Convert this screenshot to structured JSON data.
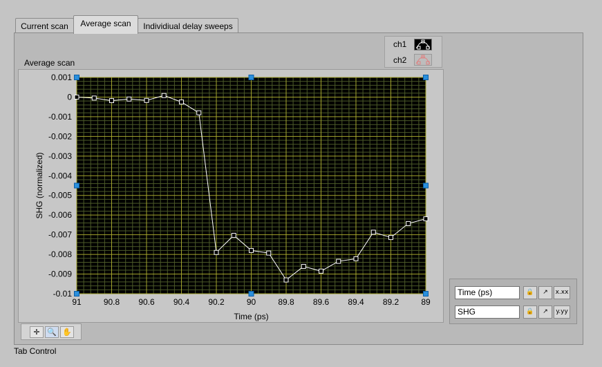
{
  "tabs": [
    {
      "label": "Current scan",
      "active": false
    },
    {
      "label": "Average scan",
      "active": true
    },
    {
      "label": "Individiual delay sweeps",
      "active": false
    }
  ],
  "graph": {
    "label": "Average scan"
  },
  "legend": {
    "items": [
      {
        "name": "ch1",
        "color": "#ffffff"
      },
      {
        "name": "ch2",
        "color": "#e08080"
      }
    ]
  },
  "scale_legend": {
    "x_name": "Time (ps)",
    "y_name": "SHG",
    "x_fmt_label": "x.xx",
    "y_fmt_label": "y.yy"
  },
  "tab_control_label": "Tab Control",
  "palette": {
    "tools": [
      "cursor-tool",
      "zoom-tool",
      "pan-tool"
    ]
  },
  "chart_data": {
    "type": "line",
    "xlabel": "Time (ps)",
    "ylabel": "SHG  (normalized)",
    "xlim": [
      91,
      89
    ],
    "ylim": [
      -0.01,
      0.001
    ],
    "x_ticks": [
      91,
      90.8,
      90.6,
      90.4,
      90.2,
      90,
      89.8,
      89.6,
      89.4,
      89.2,
      89
    ],
    "x_tick_labels": [
      "91",
      "90.8",
      "90.6",
      "90.4",
      "90.2",
      "90",
      "89.8",
      "89.6",
      "89.4",
      "89.2",
      "89"
    ],
    "y_ticks": [
      0.001,
      0,
      -0.001,
      -0.002,
      -0.003,
      -0.004,
      -0.005,
      -0.006,
      -0.007,
      -0.008,
      -0.009,
      -0.01
    ],
    "y_tick_labels": [
      "0.001",
      "0",
      "-0.001",
      "-0.002",
      "-0.003",
      "-0.004",
      "-0.005",
      "-0.006",
      "-0.007",
      "-0.008",
      "-0.009",
      "-0.01"
    ],
    "grid": true,
    "background": "#000000",
    "grid_color": "#a4a42c",
    "minor_grid_color": "#4c5a28",
    "series": [
      {
        "name": "ch1",
        "color": "#ffffff",
        "x": [
          91,
          90.9,
          90.8,
          90.7,
          90.6,
          90.5,
          90.4,
          90.3,
          90.2,
          90.1,
          90,
          89.9,
          89.8,
          89.7,
          89.6,
          89.5,
          89.4,
          89.3,
          89.2,
          89.1,
          89
        ],
        "y": [
          0,
          -5e-05,
          -0.00018,
          -0.0001,
          -0.00017,
          8e-05,
          -0.00025,
          -0.0008,
          -0.0079,
          -0.00703,
          -0.0078,
          -0.00793,
          -0.0093,
          -0.00861,
          -0.00885,
          -0.00835,
          -0.00822,
          -0.00687,
          -0.00714,
          -0.00643,
          -0.00619
        ]
      }
    ]
  }
}
